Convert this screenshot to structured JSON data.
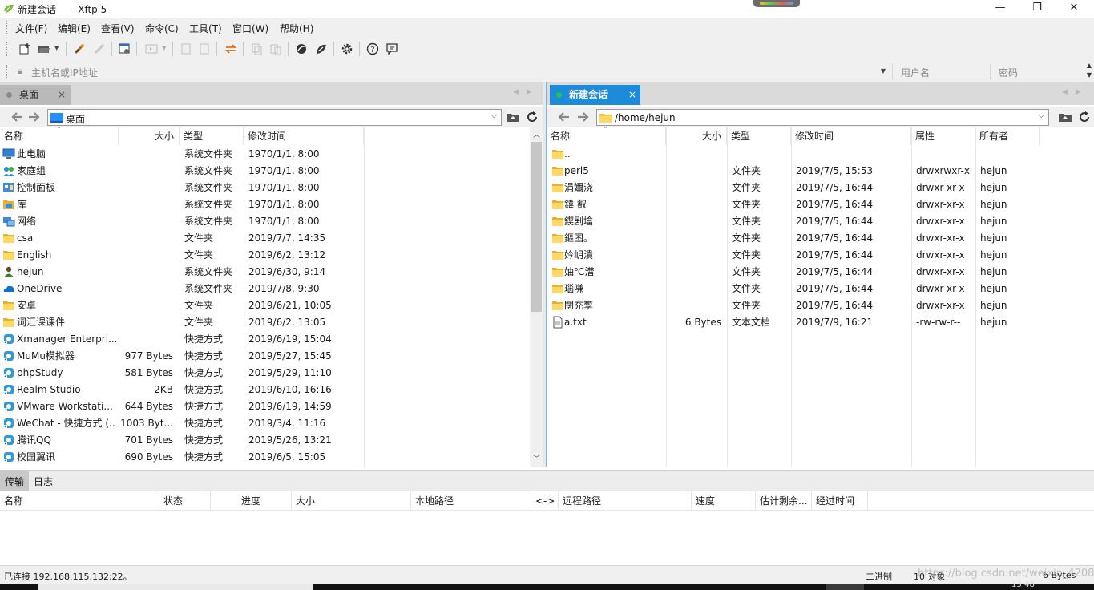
{
  "window": {
    "title": "新建会话     - Xftp 5",
    "controls": {
      "minimize": "—",
      "maximize": "❐",
      "close": "✕"
    }
  },
  "menu": [
    "文件(F)",
    "编辑(E)",
    "查看(V)",
    "命令(C)",
    "工具(T)",
    "窗口(W)",
    "帮助(H)"
  ],
  "address": {
    "host_placeholder": "主机名或IP地址",
    "user_placeholder": "用户名",
    "pass_placeholder": "密码"
  },
  "left": {
    "tab": "桌面",
    "path": "桌面",
    "columns": [
      "名称",
      "大小",
      "类型",
      "修改时间"
    ],
    "rows": [
      {
        "icon": "computer-icon",
        "name": "此电脑",
        "size": "",
        "type": "系统文件夹",
        "date": "1970/1/1, 8:00"
      },
      {
        "icon": "homegroup-icon",
        "name": "家庭组",
        "size": "",
        "type": "系统文件夹",
        "date": "1970/1/1, 8:00"
      },
      {
        "icon": "control-panel-icon",
        "name": "控制面板",
        "size": "",
        "type": "系统文件夹",
        "date": "1970/1/1, 8:00"
      },
      {
        "icon": "library-icon",
        "name": "库",
        "size": "",
        "type": "系统文件夹",
        "date": "1970/1/1, 8:00"
      },
      {
        "icon": "network-icon",
        "name": "网络",
        "size": "",
        "type": "系统文件夹",
        "date": "1970/1/1, 8:00"
      },
      {
        "icon": "folder-icon",
        "name": "csa",
        "size": "",
        "type": "文件夹",
        "date": "2019/7/7, 14:35"
      },
      {
        "icon": "folder-icon",
        "name": "English",
        "size": "",
        "type": "文件夹",
        "date": "2019/6/2, 13:12"
      },
      {
        "icon": "user-folder-icon",
        "name": "hejun",
        "size": "",
        "type": "系统文件夹",
        "date": "2019/6/30, 9:14"
      },
      {
        "icon": "onedrive-icon",
        "name": "OneDrive",
        "size": "",
        "type": "系统文件夹",
        "date": "2019/7/8, 9:30"
      },
      {
        "icon": "folder-icon",
        "name": "安卓",
        "size": "",
        "type": "文件夹",
        "date": "2019/6/21, 10:05"
      },
      {
        "icon": "folder-icon",
        "name": "词汇课课件",
        "size": "",
        "type": "文件夹",
        "date": "2019/6/2, 13:05"
      },
      {
        "icon": "shortcut-icon",
        "name": "Xmanager Enterpri...",
        "size": "",
        "type": "快捷方式",
        "date": "2019/6/19, 15:04"
      },
      {
        "icon": "shortcut-icon",
        "name": "MuMu模拟器",
        "size": "977 Bytes",
        "type": "快捷方式",
        "date": "2019/5/27, 15:45"
      },
      {
        "icon": "shortcut-icon",
        "name": "phpStudy",
        "size": "581 Bytes",
        "type": "快捷方式",
        "date": "2019/5/29, 11:10"
      },
      {
        "icon": "shortcut-icon",
        "name": "Realm Studio",
        "size": "2KB",
        "type": "快捷方式",
        "date": "2019/6/10, 16:16"
      },
      {
        "icon": "shortcut-icon",
        "name": "VMware Workstati...",
        "size": "644 Bytes",
        "type": "快捷方式",
        "date": "2019/6/19, 14:59"
      },
      {
        "icon": "shortcut-icon",
        "name": "WeChat - 快捷方式 (...",
        "size": "1003 Byt...",
        "type": "快捷方式",
        "date": "2019/3/4, 11:16"
      },
      {
        "icon": "shortcut-icon",
        "name": "腾讯QQ",
        "size": "701 Bytes",
        "type": "快捷方式",
        "date": "2019/5/26, 13:21"
      },
      {
        "icon": "shortcut-icon",
        "name": "校园翼讯",
        "size": "690 Bytes",
        "type": "快捷方式",
        "date": "2019/6/5, 15:05"
      }
    ]
  },
  "right": {
    "tab": "新建会话",
    "path": "/home/hejun",
    "columns": [
      "名称",
      "大小",
      "类型",
      "修改时间",
      "属性",
      "所有者"
    ],
    "rows": [
      {
        "icon": "folder-icon",
        "name": "..",
        "size": "",
        "type": "",
        "date": "",
        "attr": "",
        "owner": ""
      },
      {
        "icon": "folder-icon",
        "name": "perl5",
        "size": "",
        "type": "文件夹",
        "date": "2019/7/5, 15:53",
        "attr": "drwxrwxr-x",
        "owner": "hejun"
      },
      {
        "icon": "folder-icon",
        "name": "涓嬭浇",
        "size": "",
        "type": "文件夹",
        "date": "2019/7/5, 16:44",
        "attr": "drwxr-xr-x",
        "owner": "hejun"
      },
      {
        "icon": "folder-icon",
        "name": "鍏   叡",
        "size": "",
        "type": "文件夹",
        "date": "2019/7/5, 16:44",
        "attr": "drwxr-xr-x",
        "owner": "hejun"
      },
      {
        "icon": "folder-icon",
        "name": "鍥剧墖",
        "size": "",
        "type": "文件夹",
        "date": "2019/7/5, 16:44",
        "attr": "drwxr-xr-x",
        "owner": "hejun"
      },
      {
        "icon": "folder-icon",
        "name": "鏂囨。",
        "size": "",
        "type": "文件夹",
        "date": "2019/7/5, 16:44",
        "attr": "drwxr-xr-x",
        "owner": "hejun"
      },
      {
        "icon": "folder-icon",
        "name": "妗岄潰",
        "size": "",
        "type": "文件夹",
        "date": "2019/7/5, 16:44",
        "attr": "drwxr-xr-x",
        "owner": "hejun"
      },
      {
        "icon": "folder-icon",
        "name": "妯℃澘",
        "size": "",
        "type": "文件夹",
        "date": "2019/7/5, 16:44",
        "attr": "drwxr-xr-x",
        "owner": "hejun"
      },
      {
        "icon": "folder-icon",
        "name": "瑙嗛",
        "size": "",
        "type": "文件夹",
        "date": "2019/7/5, 16:44",
        "attr": "drwxr-xr-x",
        "owner": "hejun"
      },
      {
        "icon": "folder-icon",
        "name": "闊充箰",
        "size": "",
        "type": "文件夹",
        "date": "2019/7/5, 16:44",
        "attr": "drwxr-xr-x",
        "owner": "hejun"
      },
      {
        "icon": "text-file-icon",
        "name": "a.txt",
        "size": "6 Bytes",
        "type": "文本文档",
        "date": "2019/7/9, 16:21",
        "attr": "-rw-rw-r--",
        "owner": "hejun"
      }
    ]
  },
  "bottom": {
    "tabs": [
      "传输",
      "日志"
    ],
    "columns": [
      "名称",
      "状态",
      "进度",
      "大小",
      "本地路径",
      "<->",
      "远程路径",
      "速度",
      "估计剩余...",
      "经过时间"
    ]
  },
  "status": {
    "connection": "已连接 192.168.115.132:22。",
    "mode": "二进制",
    "objects": "10 对象",
    "size": "6 Bytes"
  },
  "watermark": "https://blog.csdn.net/weixin_42088925",
  "clock": "13:48",
  "colors": {
    "accent": "#1d8bdc",
    "connected": "#23c24a",
    "folder": "#f5c542"
  }
}
